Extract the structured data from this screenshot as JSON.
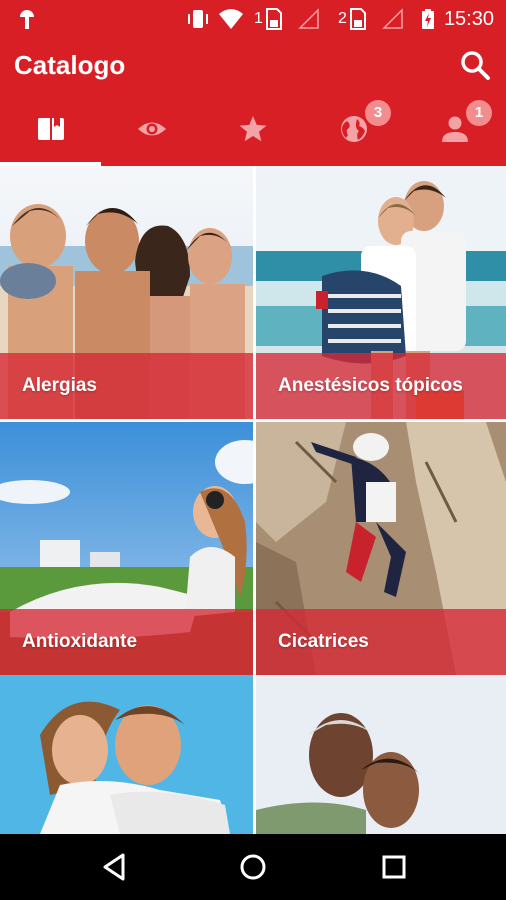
{
  "status_bar": {
    "time": "15:30",
    "sim1": "1",
    "sim2": "2",
    "icons": [
      "android-debug-icon",
      "vibrate-icon",
      "wifi-icon",
      "sim-1-icon",
      "signal-icon",
      "sim-2-icon",
      "signal-icon",
      "battery-charging-icon"
    ]
  },
  "app_bar": {
    "title": "Catalogo",
    "search_icon": "search-icon"
  },
  "tabs": [
    {
      "icon": "book-icon",
      "selected": true
    },
    {
      "icon": "eye-icon",
      "selected": false
    },
    {
      "icon": "star-icon",
      "selected": false
    },
    {
      "icon": "globe-icon",
      "badge": "3",
      "selected": false
    },
    {
      "icon": "person-icon",
      "badge": "1",
      "selected": false
    }
  ],
  "catalog": {
    "items": [
      {
        "label": "Alergias"
      },
      {
        "label": "Anestésicos tópicos"
      },
      {
        "label": "Antioxidante"
      },
      {
        "label": "Cicatrices"
      },
      {
        "label": ""
      },
      {
        "label": ""
      }
    ]
  },
  "nav_bar": {
    "icons": [
      "back-icon",
      "home-icon",
      "recents-icon"
    ]
  },
  "colors": {
    "primary": "#d91f26",
    "label_overlay": "#d62834",
    "badge": "#f28c8f"
  }
}
